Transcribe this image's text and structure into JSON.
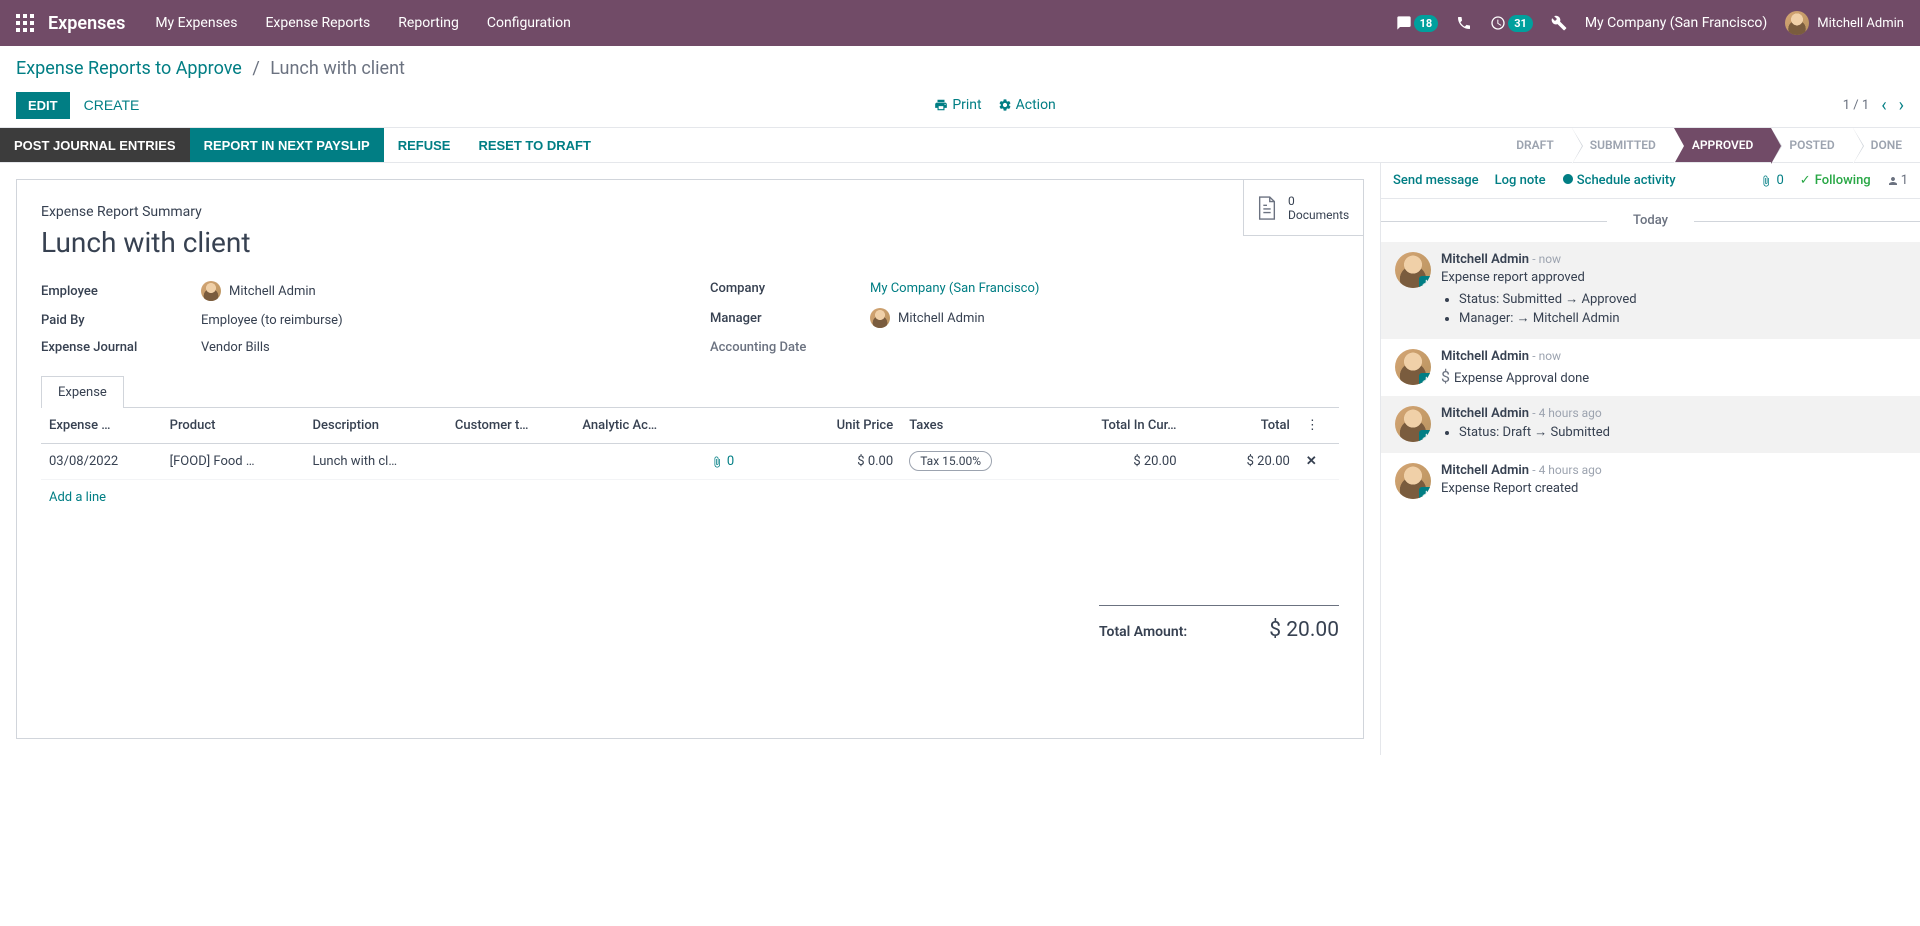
{
  "topnav": {
    "brand": "Expenses",
    "links": [
      "My Expenses",
      "Expense Reports",
      "Reporting",
      "Configuration"
    ],
    "msg_badge": "18",
    "clock_badge": "31",
    "company": "My Company (San Francisco)",
    "user": "Mitchell Admin"
  },
  "breadcrumb": {
    "parent": "Expense Reports to Approve",
    "current": "Lunch with client"
  },
  "controls": {
    "edit": "EDIT",
    "create": "CREATE",
    "print": "Print",
    "action": "Action",
    "pager": "1 / 1"
  },
  "statusbar": {
    "post": "POST JOURNAL ENTRIES",
    "payslip": "REPORT IN NEXT PAYSLIP",
    "refuse": "REFUSE",
    "reset": "RESET TO DRAFT",
    "stages": [
      "DRAFT",
      "SUBMITTED",
      "APPROVED",
      "POSTED",
      "DONE"
    ],
    "active_index": 2
  },
  "doc_btn": {
    "count": "0",
    "label": "Documents"
  },
  "form": {
    "section_label": "Expense Report Summary",
    "title": "Lunch with client",
    "employee_lbl": "Employee",
    "employee_val": "Mitchell Admin",
    "paidby_lbl": "Paid By",
    "paidby_val": "Employee (to reimburse)",
    "journal_lbl": "Expense Journal",
    "journal_val": "Vendor Bills",
    "company_lbl": "Company",
    "company_val": "My Company (San Francisco)",
    "manager_lbl": "Manager",
    "manager_val": "Mitchell Admin",
    "accdate_lbl": "Accounting Date",
    "tab": "Expense",
    "cols": {
      "date": "Expense …",
      "product": "Product",
      "desc": "Description",
      "customer": "Customer t…",
      "analytic": "Analytic Ac…",
      "attach": "",
      "unit": "Unit Price",
      "taxes": "Taxes",
      "curr": "Total In Cur…",
      "total": "Total"
    },
    "row": {
      "date": "03/08/2022",
      "product": "[FOOD] Food …",
      "desc": "Lunch with cl…",
      "customer": "",
      "analytic": "",
      "attach": "0",
      "unit": "$ 0.00",
      "taxes": "Tax 15.00%",
      "curr": "$ 20.00",
      "total": "$ 20.00"
    },
    "add_line": "Add a line",
    "total_lbl": "Total Amount:",
    "total_val": "$ 20.00"
  },
  "chatter": {
    "send": "Send message",
    "log": "Log note",
    "schedule": "Schedule activity",
    "attach_count": "0",
    "following": "Following",
    "follower_count": "1",
    "today": "Today",
    "msgs": [
      {
        "shade": true,
        "author": "Mitchell Admin",
        "time": "- now",
        "text": "Expense report approved",
        "bullets": [
          "Status: Submitted → Approved",
          "Manager: → Mitchell Admin"
        ]
      },
      {
        "shade": false,
        "author": "Mitchell Admin",
        "time": "- now",
        "icon": "coin",
        "text": "Expense Approval done"
      },
      {
        "shade": true,
        "author": "Mitchell Admin",
        "time": "- 4 hours ago",
        "bullets_only": [
          "Status: Draft → Submitted"
        ]
      },
      {
        "shade": false,
        "author": "Mitchell Admin",
        "time": "- 4 hours ago",
        "text": "Expense Report created"
      }
    ]
  }
}
